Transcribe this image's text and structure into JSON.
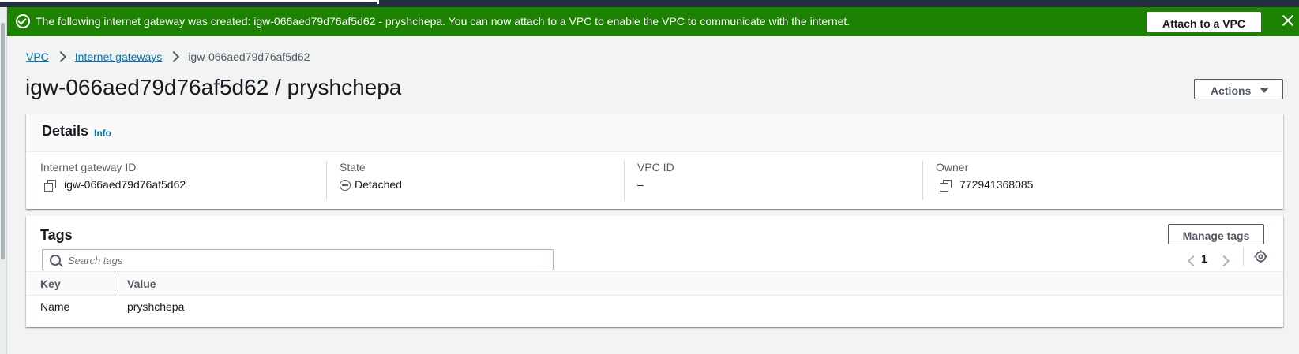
{
  "flash": {
    "message": "The following internet gateway was created: igw-066aed79d76af5d62 - pryshchepa. You can now attach to a VPC to enable the VPC to communicate with the internet.",
    "action_label": "Attach to a VPC",
    "color": "#1d8102"
  },
  "breadcrumb": {
    "items": [
      "VPC",
      "Internet gateways"
    ],
    "current": "igw-066aed79d76af5d62"
  },
  "page": {
    "title": "igw-066aed79d76af5d62 / pryshchepa",
    "actions_label": "Actions"
  },
  "details": {
    "heading": "Details",
    "info_link": "Info",
    "fields": [
      {
        "label": "Internet gateway ID",
        "value": "igw-066aed79d76af5d62",
        "icon": "copy-icon"
      },
      {
        "label": "State",
        "value": "Detached",
        "icon": "detached-icon"
      },
      {
        "label": "VPC ID",
        "value": "–"
      },
      {
        "label": "Owner",
        "value": "772941368085",
        "icon": "copy-icon"
      }
    ]
  },
  "tags": {
    "heading": "Tags",
    "manage_label": "Manage tags",
    "search_placeholder": "Search tags",
    "page_number": "1",
    "columns": [
      "Key",
      "Value"
    ],
    "rows": [
      {
        "key": "Name",
        "value": "pryshchepa"
      }
    ]
  }
}
